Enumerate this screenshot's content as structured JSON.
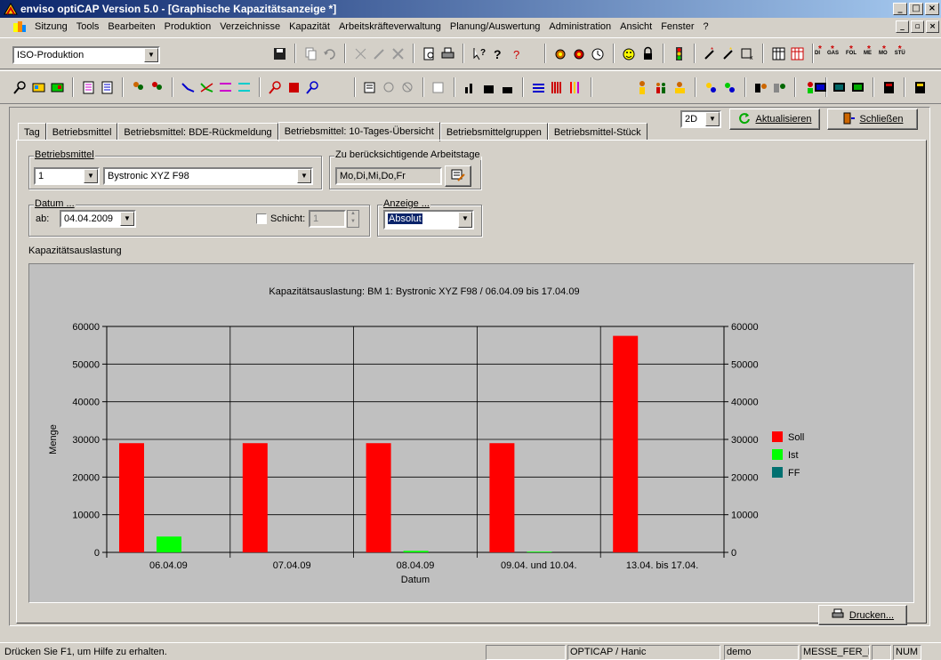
{
  "window": {
    "title": "enviso optiCAP Version 5.0 - [Graphische Kapazitätsanzeige *]"
  },
  "menu": [
    "Sitzung",
    "Tools",
    "Bearbeiten",
    "Produktion",
    "Verzeichnisse",
    "Kapazität",
    "Arbeitskräfteverwaltung",
    "Planung/Auswertung",
    "Administration",
    "Ansicht",
    "Fenster",
    "?"
  ],
  "toolbar": {
    "production_combo": "ISO-Produktion",
    "text_icons": [
      "DI",
      "GAS",
      "FOL",
      "ME",
      "MO",
      "STÜ"
    ]
  },
  "header_controls": {
    "view_mode": "2D",
    "refresh_label": "Aktualisieren",
    "close_label": "Schließen"
  },
  "tabs": [
    "Tag",
    "Betriebsmittel",
    "Betriebsmittel: BDE-Rückmeldung",
    "Betriebsmittel: 10-Tages-Übersicht",
    "Betriebsmittelgruppen",
    "Betriebsmittel-Stück"
  ],
  "active_tab": 3,
  "form": {
    "betriebsmittel_legend": "Betriebsmittel",
    "betriebsmittel_nr": "1",
    "betriebsmittel_name": "Bystronic XYZ F98",
    "arbeitstage_legend": "Zu berücksichtigende Arbeitstage",
    "arbeitstage_value": "Mo,Di,Mi,Do,Fr",
    "datum_legend": "Datum ...",
    "ab_label": "ab:",
    "ab_date": "04.04.2009",
    "schicht_label": "Schicht:",
    "schicht_value": "1",
    "anzeige_legend": "Anzeige ...",
    "anzeige_value": "Absolut",
    "section_label": "Kapazitätsauslastung"
  },
  "chart_data": {
    "type": "bar",
    "title": "Kapazitätsauslastung: BM 1: Bystronic XYZ F98 / 06.04.09 bis 17.04.09",
    "xlabel": "Datum",
    "ylabel": "Menge",
    "ylim": [
      0,
      60000
    ],
    "yticks": [
      0,
      10000,
      20000,
      30000,
      40000,
      50000,
      60000
    ],
    "categories": [
      "06.04.09",
      "07.04.09",
      "08.04.09",
      "09.04. und 10.04.",
      "13.04. bis 17.04."
    ],
    "series": [
      {
        "name": "Soll",
        "color": "#ff0000",
        "values": [
          29000,
          29000,
          29000,
          29000,
          57500
        ]
      },
      {
        "name": "Ist",
        "color": "#00ff00",
        "values": [
          4200,
          0,
          400,
          200,
          0
        ]
      },
      {
        "name": "FF",
        "color": "#007070",
        "values": [
          0,
          0,
          0,
          0,
          0
        ]
      }
    ],
    "legend_position": "right",
    "grid": true,
    "background": "#c0c0c0"
  },
  "print_label": "Drucken...",
  "statusbar": {
    "help": "Drücken Sie F1, um Hilfe zu erhalten.",
    "server": "OPTICAP / Hanic",
    "user": "demo",
    "profile": "MESSE_FER_DE_",
    "num": "NUM"
  }
}
